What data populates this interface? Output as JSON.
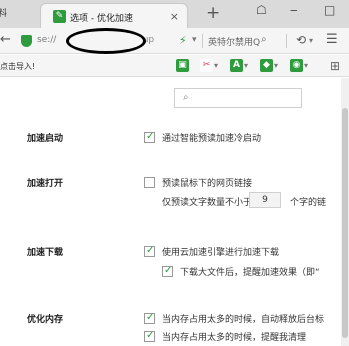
{
  "tabs": {
    "left_partial": "料",
    "active_title": "选项 - 优化加速",
    "close": "×",
    "new": "+"
  },
  "window": {
    "ctl1": "☖",
    "ctl2": "‒",
    "ctl3": "□"
  },
  "addressbar": {
    "back": "←",
    "url_prefix": "se://",
    "url_suffix": "dup",
    "flash": "⚡",
    "dropdown": "▾",
    "search_placeholder": "英特尔禁用Q",
    "search_icon": "⌕",
    "undo": "⟲",
    "menu": "☰"
  },
  "bookmarks": {
    "import_text": "点击导入!",
    "extensions": [
      {
        "icon": "screen-icon",
        "color": "#2e9b3c",
        "glyph": "▣"
      },
      {
        "icon": "scissors-icon",
        "color": "#e0334b",
        "glyph": "✂"
      },
      {
        "icon": "translate-icon",
        "color": "#2e9b3c",
        "glyph": "A"
      },
      {
        "icon": "shield-ext-icon",
        "color": "#2e9b3c",
        "glyph": "◆"
      },
      {
        "icon": "game-icon",
        "color": "#2e9b3c",
        "glyph": "◉"
      }
    ],
    "grid": "⊞"
  },
  "settings": {
    "search_placeholder": "",
    "search_icon": "⌕",
    "sections": {
      "startup_label": "加速启动",
      "startup_opt1": "通过智能预读加速冷启动",
      "open_label": "加速打开",
      "open_opt1": "预读鼠标下的网页链接",
      "open_opt2_pre": "仅预读文字数量不小于",
      "open_opt2_value": "9",
      "open_opt2_post": "个字的链",
      "download_label": "加速下载",
      "download_opt1": "使用云加速引擎进行加速下载",
      "download_opt2": "下载大文件后，提醒加速效果（即“",
      "memory_label": "优化内存",
      "memory_opt1": "当内存占用太多的时候，自动释放后台标",
      "memory_opt2": "当内存占用太多的时候，提醒我清理"
    }
  }
}
